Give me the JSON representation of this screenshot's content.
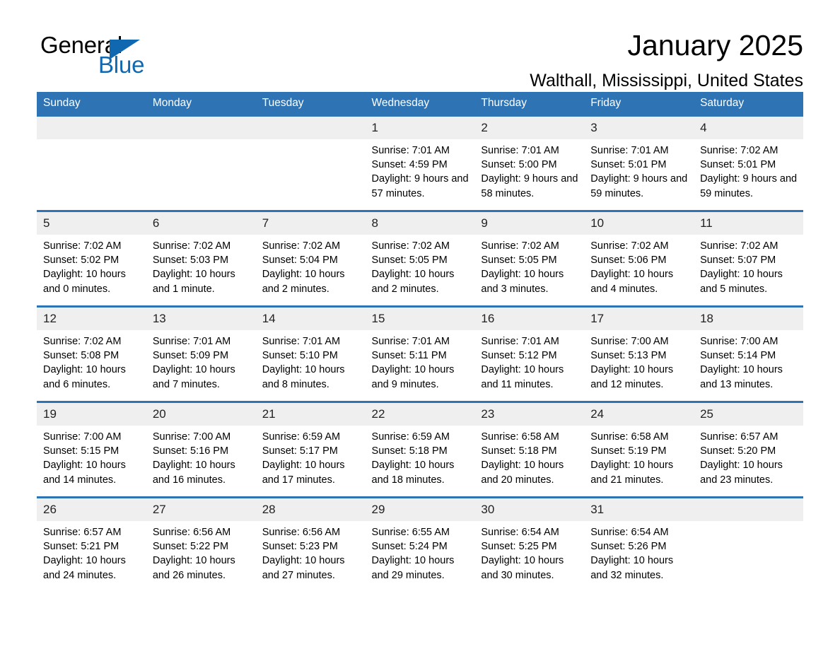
{
  "brand": {
    "name_part1": "General",
    "name_part2": "Blue",
    "accent_color": "#1068b0"
  },
  "header": {
    "month_title": "January 2025",
    "location": "Walthall, Mississippi, United States"
  },
  "theme": {
    "header_blue": "#2e74b5",
    "daynum_background": "#efefef"
  },
  "weekday_headers": [
    "Sunday",
    "Monday",
    "Tuesday",
    "Wednesday",
    "Thursday",
    "Friday",
    "Saturday"
  ],
  "weeks": [
    [
      {
        "day": "",
        "blank": true,
        "sunrise": "",
        "sunset": "",
        "daylight": ""
      },
      {
        "day": "",
        "blank": true,
        "sunrise": "",
        "sunset": "",
        "daylight": ""
      },
      {
        "day": "",
        "blank": true,
        "sunrise": "",
        "sunset": "",
        "daylight": ""
      },
      {
        "day": "1",
        "sunrise": "Sunrise: 7:01 AM",
        "sunset": "Sunset: 4:59 PM",
        "daylight": "Daylight: 9 hours and 57 minutes."
      },
      {
        "day": "2",
        "sunrise": "Sunrise: 7:01 AM",
        "sunset": "Sunset: 5:00 PM",
        "daylight": "Daylight: 9 hours and 58 minutes."
      },
      {
        "day": "3",
        "sunrise": "Sunrise: 7:01 AM",
        "sunset": "Sunset: 5:01 PM",
        "daylight": "Daylight: 9 hours and 59 minutes."
      },
      {
        "day": "4",
        "sunrise": "Sunrise: 7:02 AM",
        "sunset": "Sunset: 5:01 PM",
        "daylight": "Daylight: 9 hours and 59 minutes."
      }
    ],
    [
      {
        "day": "5",
        "sunrise": "Sunrise: 7:02 AM",
        "sunset": "Sunset: 5:02 PM",
        "daylight": "Daylight: 10 hours and 0 minutes."
      },
      {
        "day": "6",
        "sunrise": "Sunrise: 7:02 AM",
        "sunset": "Sunset: 5:03 PM",
        "daylight": "Daylight: 10 hours and 1 minute."
      },
      {
        "day": "7",
        "sunrise": "Sunrise: 7:02 AM",
        "sunset": "Sunset: 5:04 PM",
        "daylight": "Daylight: 10 hours and 2 minutes."
      },
      {
        "day": "8",
        "sunrise": "Sunrise: 7:02 AM",
        "sunset": "Sunset: 5:05 PM",
        "daylight": "Daylight: 10 hours and 2 minutes."
      },
      {
        "day": "9",
        "sunrise": "Sunrise: 7:02 AM",
        "sunset": "Sunset: 5:05 PM",
        "daylight": "Daylight: 10 hours and 3 minutes."
      },
      {
        "day": "10",
        "sunrise": "Sunrise: 7:02 AM",
        "sunset": "Sunset: 5:06 PM",
        "daylight": "Daylight: 10 hours and 4 minutes."
      },
      {
        "day": "11",
        "sunrise": "Sunrise: 7:02 AM",
        "sunset": "Sunset: 5:07 PM",
        "daylight": "Daylight: 10 hours and 5 minutes."
      }
    ],
    [
      {
        "day": "12",
        "sunrise": "Sunrise: 7:02 AM",
        "sunset": "Sunset: 5:08 PM",
        "daylight": "Daylight: 10 hours and 6 minutes."
      },
      {
        "day": "13",
        "sunrise": "Sunrise: 7:01 AM",
        "sunset": "Sunset: 5:09 PM",
        "daylight": "Daylight: 10 hours and 7 minutes."
      },
      {
        "day": "14",
        "sunrise": "Sunrise: 7:01 AM",
        "sunset": "Sunset: 5:10 PM",
        "daylight": "Daylight: 10 hours and 8 minutes."
      },
      {
        "day": "15",
        "sunrise": "Sunrise: 7:01 AM",
        "sunset": "Sunset: 5:11 PM",
        "daylight": "Daylight: 10 hours and 9 minutes."
      },
      {
        "day": "16",
        "sunrise": "Sunrise: 7:01 AM",
        "sunset": "Sunset: 5:12 PM",
        "daylight": "Daylight: 10 hours and 11 minutes."
      },
      {
        "day": "17",
        "sunrise": "Sunrise: 7:00 AM",
        "sunset": "Sunset: 5:13 PM",
        "daylight": "Daylight: 10 hours and 12 minutes."
      },
      {
        "day": "18",
        "sunrise": "Sunrise: 7:00 AM",
        "sunset": "Sunset: 5:14 PM",
        "daylight": "Daylight: 10 hours and 13 minutes."
      }
    ],
    [
      {
        "day": "19",
        "sunrise": "Sunrise: 7:00 AM",
        "sunset": "Sunset: 5:15 PM",
        "daylight": "Daylight: 10 hours and 14 minutes."
      },
      {
        "day": "20",
        "sunrise": "Sunrise: 7:00 AM",
        "sunset": "Sunset: 5:16 PM",
        "daylight": "Daylight: 10 hours and 16 minutes."
      },
      {
        "day": "21",
        "sunrise": "Sunrise: 6:59 AM",
        "sunset": "Sunset: 5:17 PM",
        "daylight": "Daylight: 10 hours and 17 minutes."
      },
      {
        "day": "22",
        "sunrise": "Sunrise: 6:59 AM",
        "sunset": "Sunset: 5:18 PM",
        "daylight": "Daylight: 10 hours and 18 minutes."
      },
      {
        "day": "23",
        "sunrise": "Sunrise: 6:58 AM",
        "sunset": "Sunset: 5:18 PM",
        "daylight": "Daylight: 10 hours and 20 minutes."
      },
      {
        "day": "24",
        "sunrise": "Sunrise: 6:58 AM",
        "sunset": "Sunset: 5:19 PM",
        "daylight": "Daylight: 10 hours and 21 minutes."
      },
      {
        "day": "25",
        "sunrise": "Sunrise: 6:57 AM",
        "sunset": "Sunset: 5:20 PM",
        "daylight": "Daylight: 10 hours and 23 minutes."
      }
    ],
    [
      {
        "day": "26",
        "sunrise": "Sunrise: 6:57 AM",
        "sunset": "Sunset: 5:21 PM",
        "daylight": "Daylight: 10 hours and 24 minutes."
      },
      {
        "day": "27",
        "sunrise": "Sunrise: 6:56 AM",
        "sunset": "Sunset: 5:22 PM",
        "daylight": "Daylight: 10 hours and 26 minutes."
      },
      {
        "day": "28",
        "sunrise": "Sunrise: 6:56 AM",
        "sunset": "Sunset: 5:23 PM",
        "daylight": "Daylight: 10 hours and 27 minutes."
      },
      {
        "day": "29",
        "sunrise": "Sunrise: 6:55 AM",
        "sunset": "Sunset: 5:24 PM",
        "daylight": "Daylight: 10 hours and 29 minutes."
      },
      {
        "day": "30",
        "sunrise": "Sunrise: 6:54 AM",
        "sunset": "Sunset: 5:25 PM",
        "daylight": "Daylight: 10 hours and 30 minutes."
      },
      {
        "day": "31",
        "sunrise": "Sunrise: 6:54 AM",
        "sunset": "Sunset: 5:26 PM",
        "daylight": "Daylight: 10 hours and 32 minutes."
      },
      {
        "day": "",
        "blank": true,
        "sunrise": "",
        "sunset": "",
        "daylight": ""
      }
    ]
  ]
}
